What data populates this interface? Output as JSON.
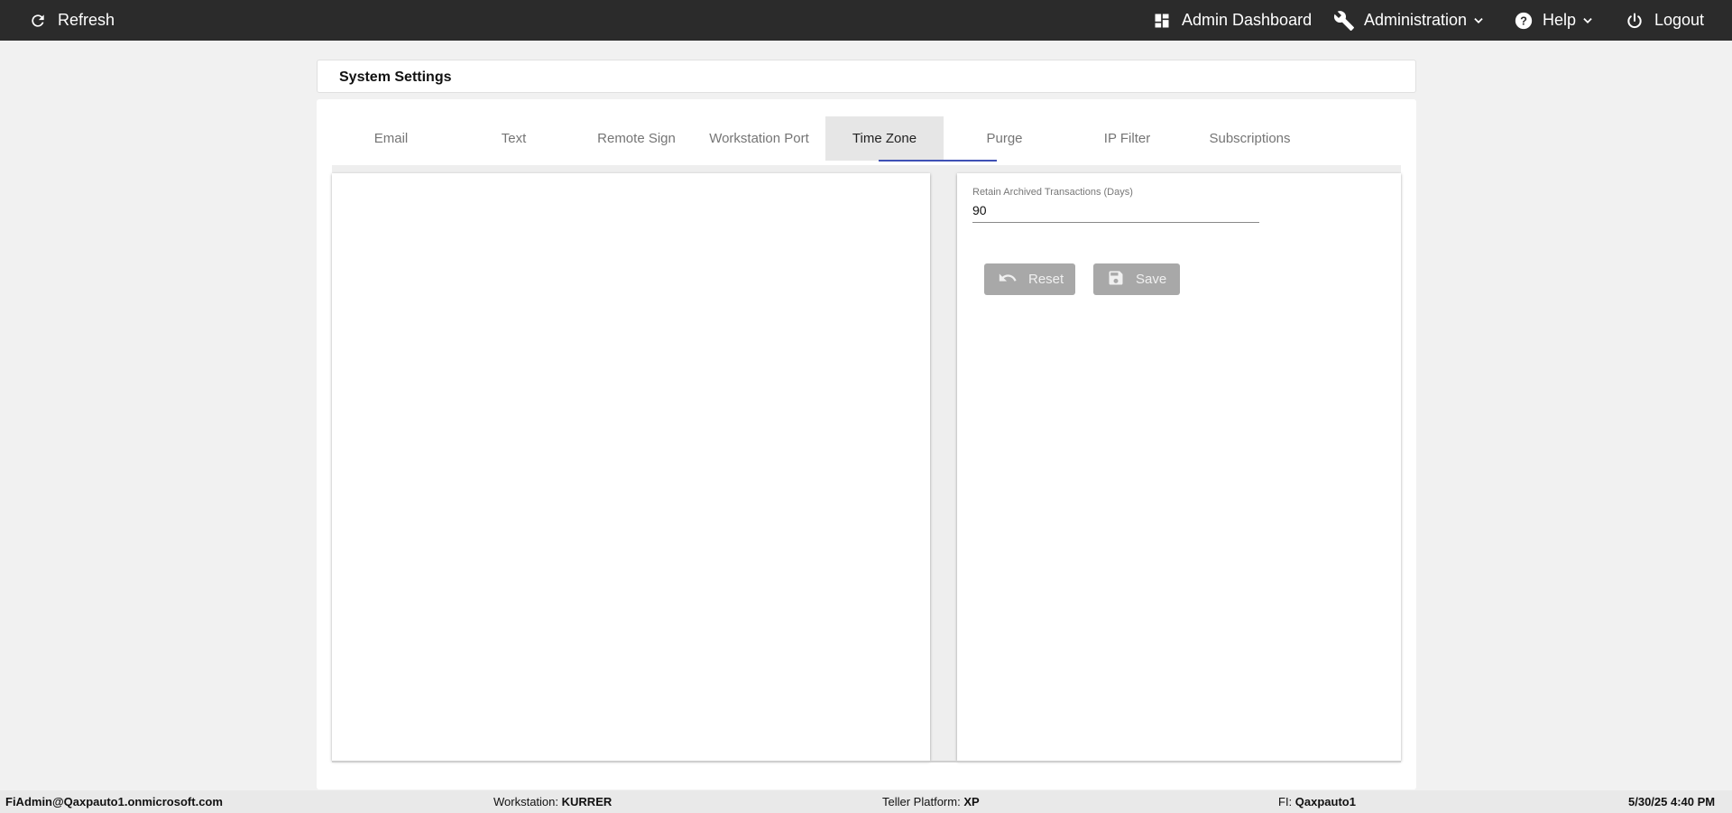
{
  "topbar": {
    "refresh": {
      "label": "Refresh",
      "icon": "refresh-icon"
    },
    "admin_dashboard": {
      "label": "Admin Dashboard",
      "icon": "dashboard-icon"
    },
    "administration": {
      "label": "Administration",
      "icon": "wrench-icon"
    },
    "help": {
      "label": "Help",
      "icon": "help-circle-icon"
    },
    "logout": {
      "label": "Logout",
      "icon": "power-icon"
    }
  },
  "page": {
    "title": "System Settings"
  },
  "tabs": [
    {
      "label": "Email"
    },
    {
      "label": "Text"
    },
    {
      "label": "Remote Sign"
    },
    {
      "label": "Workstation Port"
    },
    {
      "label": "Time Zone",
      "active": true
    },
    {
      "label": "Purge"
    },
    {
      "label": "IP Filter"
    },
    {
      "label": "Subscriptions"
    }
  ],
  "purge": {
    "retain_label": "Retain Archived Transactions (Days)",
    "retain_value": "90",
    "reset_label": "Reset",
    "save_label": "Save"
  },
  "statusbar": {
    "user": "FiAdmin@Qaxpauto1.onmicrosoft.com",
    "workstation_label": "Workstation:",
    "workstation_value": "KURRER",
    "teller_platform_label": "Teller Platform:",
    "teller_platform_value": "XP",
    "fi_label": "FI:",
    "fi_value": "Qaxpauto1",
    "datetime": "5/30/25 4:40 PM"
  },
  "colors": {
    "topbar_bg": "#2b2b2b",
    "tab_ink": "#3f51b5",
    "button_disabled": "#a8a8a8",
    "page_bg": "#f1f1f1"
  }
}
